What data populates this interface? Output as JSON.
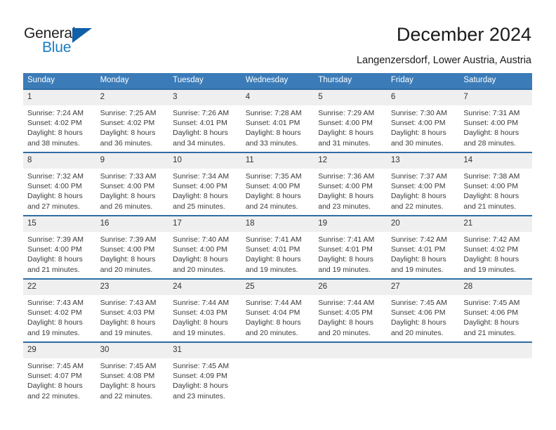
{
  "brand": {
    "name_part1": "General",
    "name_part2": "Blue",
    "triangle_color": "#1060a8",
    "blue_color": "#1a7cc4"
  },
  "header": {
    "title": "December 2024",
    "subtitle": "Langenzersdorf, Lower Austria, Austria"
  },
  "theme": {
    "header_blue": "#3b7cb8",
    "row_rule_blue": "#2e6da4",
    "daynum_band": "#efefef"
  },
  "weekdays": [
    "Sunday",
    "Monday",
    "Tuesday",
    "Wednesday",
    "Thursday",
    "Friday",
    "Saturday"
  ],
  "weeks": [
    [
      {
        "day": "1",
        "sunrise": "Sunrise: 7:24 AM",
        "sunset": "Sunset: 4:02 PM",
        "daylight1": "Daylight: 8 hours",
        "daylight2": "and 38 minutes."
      },
      {
        "day": "2",
        "sunrise": "Sunrise: 7:25 AM",
        "sunset": "Sunset: 4:02 PM",
        "daylight1": "Daylight: 8 hours",
        "daylight2": "and 36 minutes."
      },
      {
        "day": "3",
        "sunrise": "Sunrise: 7:26 AM",
        "sunset": "Sunset: 4:01 PM",
        "daylight1": "Daylight: 8 hours",
        "daylight2": "and 34 minutes."
      },
      {
        "day": "4",
        "sunrise": "Sunrise: 7:28 AM",
        "sunset": "Sunset: 4:01 PM",
        "daylight1": "Daylight: 8 hours",
        "daylight2": "and 33 minutes."
      },
      {
        "day": "5",
        "sunrise": "Sunrise: 7:29 AM",
        "sunset": "Sunset: 4:00 PM",
        "daylight1": "Daylight: 8 hours",
        "daylight2": "and 31 minutes."
      },
      {
        "day": "6",
        "sunrise": "Sunrise: 7:30 AM",
        "sunset": "Sunset: 4:00 PM",
        "daylight1": "Daylight: 8 hours",
        "daylight2": "and 30 minutes."
      },
      {
        "day": "7",
        "sunrise": "Sunrise: 7:31 AM",
        "sunset": "Sunset: 4:00 PM",
        "daylight1": "Daylight: 8 hours",
        "daylight2": "and 28 minutes."
      }
    ],
    [
      {
        "day": "8",
        "sunrise": "Sunrise: 7:32 AM",
        "sunset": "Sunset: 4:00 PM",
        "daylight1": "Daylight: 8 hours",
        "daylight2": "and 27 minutes."
      },
      {
        "day": "9",
        "sunrise": "Sunrise: 7:33 AM",
        "sunset": "Sunset: 4:00 PM",
        "daylight1": "Daylight: 8 hours",
        "daylight2": "and 26 minutes."
      },
      {
        "day": "10",
        "sunrise": "Sunrise: 7:34 AM",
        "sunset": "Sunset: 4:00 PM",
        "daylight1": "Daylight: 8 hours",
        "daylight2": "and 25 minutes."
      },
      {
        "day": "11",
        "sunrise": "Sunrise: 7:35 AM",
        "sunset": "Sunset: 4:00 PM",
        "daylight1": "Daylight: 8 hours",
        "daylight2": "and 24 minutes."
      },
      {
        "day": "12",
        "sunrise": "Sunrise: 7:36 AM",
        "sunset": "Sunset: 4:00 PM",
        "daylight1": "Daylight: 8 hours",
        "daylight2": "and 23 minutes."
      },
      {
        "day": "13",
        "sunrise": "Sunrise: 7:37 AM",
        "sunset": "Sunset: 4:00 PM",
        "daylight1": "Daylight: 8 hours",
        "daylight2": "and 22 minutes."
      },
      {
        "day": "14",
        "sunrise": "Sunrise: 7:38 AM",
        "sunset": "Sunset: 4:00 PM",
        "daylight1": "Daylight: 8 hours",
        "daylight2": "and 21 minutes."
      }
    ],
    [
      {
        "day": "15",
        "sunrise": "Sunrise: 7:39 AM",
        "sunset": "Sunset: 4:00 PM",
        "daylight1": "Daylight: 8 hours",
        "daylight2": "and 21 minutes."
      },
      {
        "day": "16",
        "sunrise": "Sunrise: 7:39 AM",
        "sunset": "Sunset: 4:00 PM",
        "daylight1": "Daylight: 8 hours",
        "daylight2": "and 20 minutes."
      },
      {
        "day": "17",
        "sunrise": "Sunrise: 7:40 AM",
        "sunset": "Sunset: 4:00 PM",
        "daylight1": "Daylight: 8 hours",
        "daylight2": "and 20 minutes."
      },
      {
        "day": "18",
        "sunrise": "Sunrise: 7:41 AM",
        "sunset": "Sunset: 4:01 PM",
        "daylight1": "Daylight: 8 hours",
        "daylight2": "and 19 minutes."
      },
      {
        "day": "19",
        "sunrise": "Sunrise: 7:41 AM",
        "sunset": "Sunset: 4:01 PM",
        "daylight1": "Daylight: 8 hours",
        "daylight2": "and 19 minutes."
      },
      {
        "day": "20",
        "sunrise": "Sunrise: 7:42 AM",
        "sunset": "Sunset: 4:01 PM",
        "daylight1": "Daylight: 8 hours",
        "daylight2": "and 19 minutes."
      },
      {
        "day": "21",
        "sunrise": "Sunrise: 7:42 AM",
        "sunset": "Sunset: 4:02 PM",
        "daylight1": "Daylight: 8 hours",
        "daylight2": "and 19 minutes."
      }
    ],
    [
      {
        "day": "22",
        "sunrise": "Sunrise: 7:43 AM",
        "sunset": "Sunset: 4:02 PM",
        "daylight1": "Daylight: 8 hours",
        "daylight2": "and 19 minutes."
      },
      {
        "day": "23",
        "sunrise": "Sunrise: 7:43 AM",
        "sunset": "Sunset: 4:03 PM",
        "daylight1": "Daylight: 8 hours",
        "daylight2": "and 19 minutes."
      },
      {
        "day": "24",
        "sunrise": "Sunrise: 7:44 AM",
        "sunset": "Sunset: 4:03 PM",
        "daylight1": "Daylight: 8 hours",
        "daylight2": "and 19 minutes."
      },
      {
        "day": "25",
        "sunrise": "Sunrise: 7:44 AM",
        "sunset": "Sunset: 4:04 PM",
        "daylight1": "Daylight: 8 hours",
        "daylight2": "and 20 minutes."
      },
      {
        "day": "26",
        "sunrise": "Sunrise: 7:44 AM",
        "sunset": "Sunset: 4:05 PM",
        "daylight1": "Daylight: 8 hours",
        "daylight2": "and 20 minutes."
      },
      {
        "day": "27",
        "sunrise": "Sunrise: 7:45 AM",
        "sunset": "Sunset: 4:06 PM",
        "daylight1": "Daylight: 8 hours",
        "daylight2": "and 20 minutes."
      },
      {
        "day": "28",
        "sunrise": "Sunrise: 7:45 AM",
        "sunset": "Sunset: 4:06 PM",
        "daylight1": "Daylight: 8 hours",
        "daylight2": "and 21 minutes."
      }
    ],
    [
      {
        "day": "29",
        "sunrise": "Sunrise: 7:45 AM",
        "sunset": "Sunset: 4:07 PM",
        "daylight1": "Daylight: 8 hours",
        "daylight2": "and 22 minutes."
      },
      {
        "day": "30",
        "sunrise": "Sunrise: 7:45 AM",
        "sunset": "Sunset: 4:08 PM",
        "daylight1": "Daylight: 8 hours",
        "daylight2": "and 22 minutes."
      },
      {
        "day": "31",
        "sunrise": "Sunrise: 7:45 AM",
        "sunset": "Sunset: 4:09 PM",
        "daylight1": "Daylight: 8 hours",
        "daylight2": "and 23 minutes."
      },
      {
        "day": "",
        "sunrise": "",
        "sunset": "",
        "daylight1": "",
        "daylight2": ""
      },
      {
        "day": "",
        "sunrise": "",
        "sunset": "",
        "daylight1": "",
        "daylight2": ""
      },
      {
        "day": "",
        "sunrise": "",
        "sunset": "",
        "daylight1": "",
        "daylight2": ""
      },
      {
        "day": "",
        "sunrise": "",
        "sunset": "",
        "daylight1": "",
        "daylight2": ""
      }
    ]
  ]
}
